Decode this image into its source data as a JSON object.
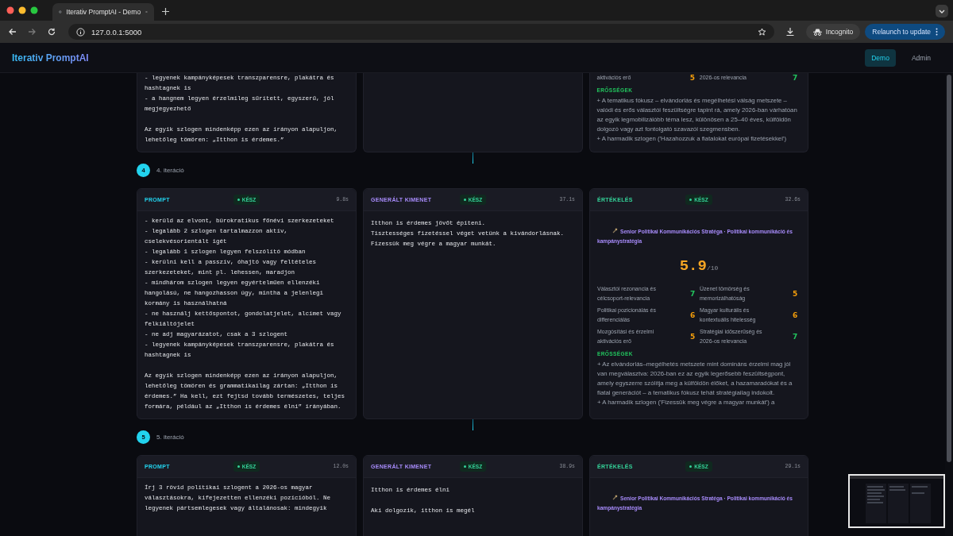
{
  "browser": {
    "tab_title": "Iterativ PromptAI - Demo",
    "url": "127.0.0.1:5000",
    "incognito_label": "Incognito",
    "relaunch_label": "Relaunch to update"
  },
  "header": {
    "brand": "Iterativ PromptAI",
    "nav": [
      {
        "label": "Demo",
        "selected": true
      },
      {
        "label": "Admin",
        "selected": false
      }
    ]
  },
  "previous_tail": {
    "prompt_text": "- legyenek kampányképesek transzparensre, plakátra és hashtagnek is\n- a hangnem legyen érzelmileg sűrített, egyszerű, jól megjegyezhető\n\nAz egyik szlogen mindenképp ezen az irányon alapuljon, lehetőleg tömören: „Itthon is érdemes.”",
    "evaluation": {
      "criteria": [
        {
          "label": "aktivációs erő",
          "score": "5",
          "color": "#f59e0b"
        },
        {
          "label": "2026-os relevancia",
          "score": "7",
          "color": "#22c55e"
        }
      ],
      "strengths_title": "ERŐSSÉGEK",
      "strengths": [
        "+ A tematikus fókusz – elvándorlás és megélhetési válság metszete – valódi és erős választói feszültségre tapint rá, amely 2026-ban várhatóan az egyik legmobilizálóbb téma lesz, különösen a 25–40 éves, külföldön dolgozó vagy azt fontolgató szavazói szegmensben.",
        "+ A harmadik szlogen ('Hazahozzuk a fiatalokat európai fizetésekkel')"
      ]
    }
  },
  "iterations": [
    {
      "number": "4",
      "title": "4. iteráció",
      "cards": [
        {
          "kind": "prompt",
          "label": "PROMPT",
          "status": "KÉSZ",
          "time": "9.8s",
          "text": "- kerüld az elvont, bürokratikus főnévi szerkezeteket\n- legalább 2 szlogen tartalmazzon aktív, cselekvésorientált igét\n- legalább 1 szlogen legyen felszólító módban\n- kerülni kell a passzív, óhajtó vagy feltételes szerkezeteket, mint pl. lehessen, maradjon\n- mindhárom szlogen legyen egyértelműen ellenzéki hangolású, ne hangozhasson úgy, mintha a jelenlegi kormány is használhatná\n- ne használj kettőspontot, gondolatjelet, alcímet vagy felkiáltójelet\n- ne adj magyarázatot, csak a 3 szlogent\n- legyenek kampányképesek transzparensre, plakátra és hashtagnek is\n\nAz egyik szlogen mindenképp ezen az irányon alapuljon, lehetőleg tömören és grammatikailag zártan: „Itthon is érdemes.” Ha kell, ezt fejtsd tovább természetes, teljes formára, például az „Itthon is érdemes élni” irányában."
        },
        {
          "kind": "output",
          "label": "GENERÁLT KIMENET",
          "status": "KÉSZ",
          "time": "37.1s",
          "text": "Itthon is érdemes jövőt építeni.\nTisztességes fizetéssel véget vetünk a kivándorlásnak.\nFizessük meg végre a magyar munkát."
        },
        {
          "kind": "evaluation",
          "label": "ÉRTÉKELÉS",
          "status": "KÉSZ",
          "time": "32.6s",
          "persona": "Senior Politikai Kommunikációs Stratéga · Politikai kommunikáció és kampánystratégia",
          "score": "5.9",
          "score_max": "/10",
          "criteria": [
            {
              "label": "Választói rezonancia és célcsoport-relevancia",
              "score": "7",
              "color": "#22c55e"
            },
            {
              "label": "Üzenet tömörség és memorizálhatóság",
              "score": "5",
              "color": "#f59e0b"
            },
            {
              "label": "Politikai pozicionálás és differenciálás",
              "score": "6",
              "color": "#f59e0b"
            },
            {
              "label": "Magyar kulturális és kontextuális hitelesség",
              "score": "6",
              "color": "#f59e0b"
            },
            {
              "label": "Mozgósítási és érzelmi aktivációs erő",
              "score": "5",
              "color": "#f59e0b"
            },
            {
              "label": "Stratégiai időszerűség és 2026-os relevancia",
              "score": "7",
              "color": "#22c55e"
            }
          ],
          "strengths_title": "ERŐSSÉGEK",
          "strengths": [
            "+ Az elvándorlás–megélhetés metszete mint domináns érzelmi mag jól van megválasztva: 2026-ban ez az egyik legerősebb feszültségpont, amely egyszerre szólítja meg a külföldön élőket, a hazamaradókat és a fiatal generációt – a tematikus fókusz tehát stratégiailag indokolt.",
            "+ A harmadik szlogen ('Fizessük meg végre a magyar munkát') a"
          ]
        }
      ]
    },
    {
      "number": "5",
      "title": "5. iteráció",
      "cards": [
        {
          "kind": "prompt",
          "label": "PROMPT",
          "status": "KÉSZ",
          "time": "12.0s",
          "text": "Írj 3 rövid politikai szlogent a 2026-os magyar választásokra, kifejezetten ellenzéki pozícióból. Ne legyenek pártsemlegesek vagy általánosak: mindegyik"
        },
        {
          "kind": "output",
          "label": "GENERÁLT KIMENET",
          "status": "KÉSZ",
          "time": "38.9s",
          "text": "Itthon is érdemes élni\n\nAki dolgozik, itthon is megél"
        },
        {
          "kind": "evaluation",
          "label": "ÉRTÉKELÉS",
          "status": "KÉSZ",
          "time": "29.1s",
          "persona": "Senior Politikai Kommunikációs Stratéga · Politikai kommunikáció és kampánystratégia"
        }
      ]
    }
  ]
}
